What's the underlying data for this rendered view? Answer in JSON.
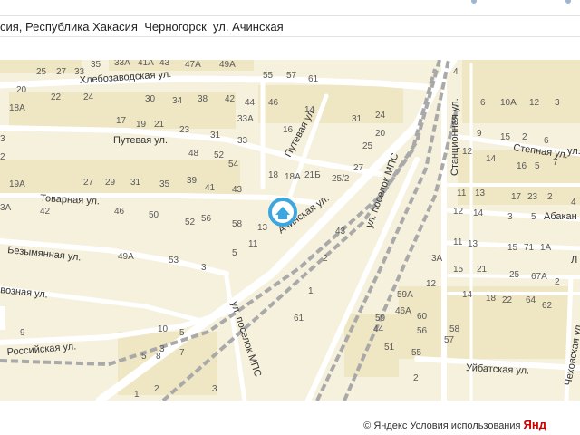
{
  "address": {
    "text": "сия, Республика Хакасия  Черногорск  ул. Ачинская"
  },
  "map": {
    "marker_icon": "house-marker-icon",
    "colors": {
      "background": "#f6f1dc",
      "road": "#ffffff",
      "railway": "#a9a9a9",
      "block": "#efe6c3",
      "marker": "#3ba6e0"
    },
    "streets": [
      {
        "id": "hlebozavodskaya",
        "label": "Хлебозаводская ул."
      },
      {
        "id": "putevaya",
        "label": "Путевая ул."
      },
      {
        "id": "putevaya-diag",
        "label": "Путевая ул."
      },
      {
        "id": "tovarnaya",
        "label": "Товарная ул."
      },
      {
        "id": "achinskaya",
        "label": "Ачинская ул."
      },
      {
        "id": "bezymyannaya",
        "label": "Безымянная ул."
      },
      {
        "id": "vozvoznaya",
        "label": "возная ул."
      },
      {
        "id": "rossiyskaya",
        "label": "Российская ул."
      },
      {
        "id": "poselok-mps-1",
        "label": "ул. поселок МПС"
      },
      {
        "id": "poselok-mps-2",
        "label": "ул. поселок МПС"
      },
      {
        "id": "stantsionnaya",
        "label": "Станционная ул."
      },
      {
        "id": "stepnaya",
        "label": "Степная ул."
      },
      {
        "id": "abakanskaya",
        "label": "Абакан"
      },
      {
        "id": "uybatskaya",
        "label": "Уйбатская ул."
      },
      {
        "id": "chekhovskaya",
        "label": "Чеховская ул."
      },
      {
        "id": "edge-l",
        "label": "Л"
      },
      {
        "id": "ul-edge",
        "label": "ул."
      }
    ],
    "house_numbers": [
      "25",
      "27",
      "33",
      "35",
      "33А",
      "41А",
      "43",
      "47А",
      "49А",
      "55",
      "57",
      "61",
      "20",
      "22",
      "24",
      "30",
      "34",
      "38",
      "42",
      "44",
      "46",
      "14",
      "18А",
      "17",
      "19",
      "21",
      "23",
      "31",
      "33А",
      "33",
      "16",
      "31",
      "24",
      "20",
      "3",
      "2",
      "48",
      "52",
      "54",
      "25",
      "18",
      "18А",
      "21Б",
      "25/2",
      "27",
      "19А",
      "27",
      "29",
      "31",
      "35",
      "39",
      "41",
      "43",
      "3А",
      "42",
      "46",
      "50",
      "52",
      "56",
      "58",
      "13",
      "11",
      "5",
      "43",
      "49А",
      "53",
      "3",
      "2",
      "1",
      "61",
      "9",
      "10",
      "5",
      "3",
      "5",
      "8",
      "7",
      "3",
      "2",
      "1",
      "4",
      "6",
      "10А",
      "12",
      "3",
      "5",
      "9",
      "15",
      "2",
      "6",
      "12",
      "14",
      "16",
      "5",
      "7",
      "11",
      "13",
      "17",
      "23",
      "2",
      "4",
      "12",
      "14",
      "3",
      "5",
      "11",
      "13",
      "15",
      "71",
      "1А",
      "3А",
      "15",
      "21",
      "25",
      "67А",
      "2",
      "12",
      "14",
      "18",
      "22",
      "64",
      "62",
      "59А",
      "46А",
      "60",
      "58",
      "59",
      "44",
      "56",
      "57",
      "51",
      "55",
      "2"
    ],
    "attribution_prefix": "© Яндекс",
    "attribution_terms": "Условия использования",
    "attribution_logo": "Янд"
  }
}
